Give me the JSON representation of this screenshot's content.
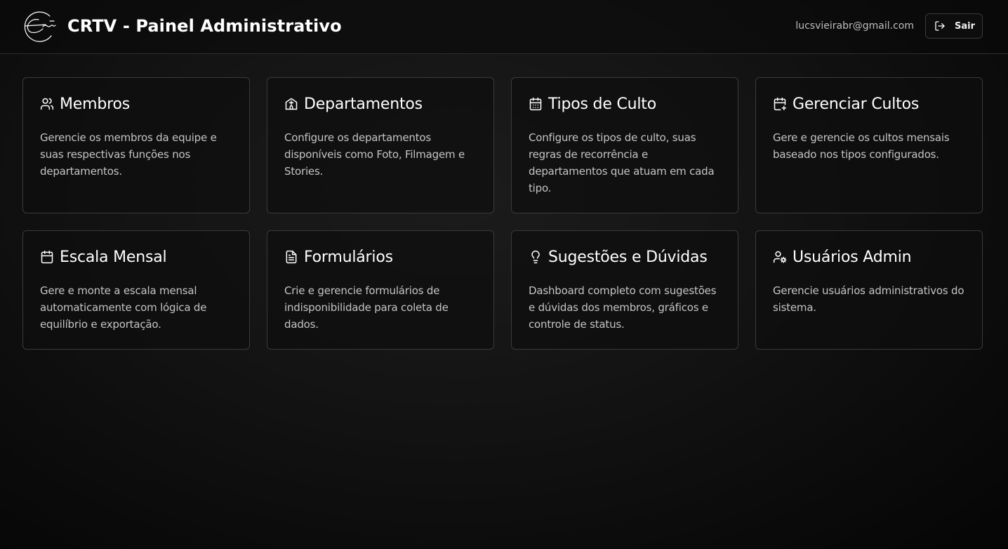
{
  "header": {
    "title": "CRTV - Painel Administrativo",
    "logo_icon": "crtv-signature-logo",
    "user_email": "lucsvieirabr@gmail.com",
    "logout_label": "Sair",
    "logout_icon": "log-out-icon"
  },
  "cards": [
    {
      "title": "Membros",
      "icon": "users-icon",
      "description": "Gerencie os membros da equipe e suas respectivas funções nos departamentos."
    },
    {
      "title": "Departamentos",
      "icon": "building-icon",
      "description": "Configure os departamentos disponíveis como Foto, Filmagem e Stories."
    },
    {
      "title": "Tipos de Culto",
      "icon": "calendar-days-icon",
      "description": "Configure os tipos de culto, suas regras de recorrência e departamentos que atuam em cada tipo."
    },
    {
      "title": "Gerenciar Cultos",
      "icon": "calendar-plus-icon",
      "description": "Gere e gerencie os cultos mensais baseado nos tipos configurados."
    },
    {
      "title": "Escala Mensal",
      "icon": "calendar-icon",
      "description": "Gere e monte a escala mensal automaticamente com lógica de equilíbrio e exportação."
    },
    {
      "title": "Formulários",
      "icon": "file-text-icon",
      "description": "Crie e gerencie formulários de indisponibilidade para coleta de dados."
    },
    {
      "title": "Sugestões e Dúvidas",
      "icon": "lightbulb-icon",
      "description": "Dashboard completo com sugestões e dúvidas dos membros, gráficos e controle de status."
    },
    {
      "title": "Usuários Admin",
      "icon": "user-cog-icon",
      "description": "Gerencie usuários administrativos do sistema."
    }
  ],
  "colors": {
    "background": "#111111",
    "card_border": "#3a3a3a",
    "text_primary": "#ffffff",
    "text_secondary": "#c4c4c4"
  }
}
